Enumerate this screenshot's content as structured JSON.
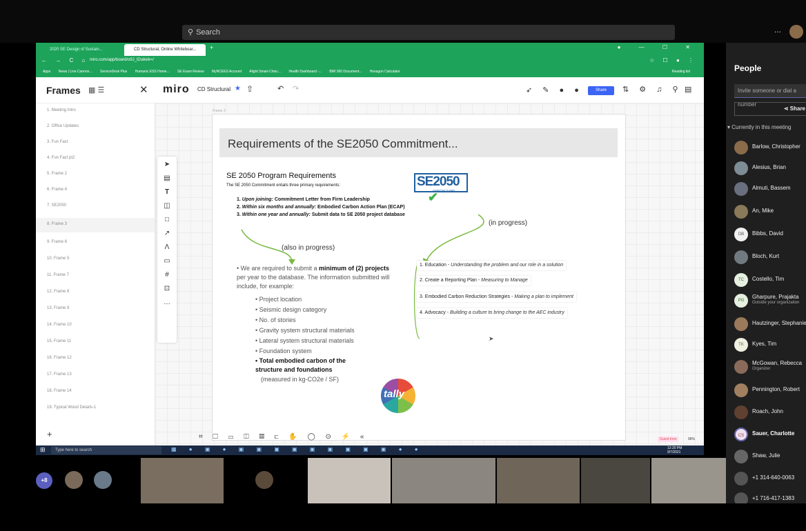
{
  "teams": {
    "search_placeholder": "Search",
    "more": "...",
    "people": {
      "title": "People",
      "invite_placeholder": "Invite someone or dial a number",
      "share_label": "Share",
      "section_label": "Currently in this meeting",
      "members": [
        {
          "name": "Barlow, Christopher",
          "initials": "",
          "sub": ""
        },
        {
          "name": "Alesius, Brian",
          "initials": "",
          "sub": ""
        },
        {
          "name": "Almuti, Bassem",
          "initials": "",
          "sub": ""
        },
        {
          "name": "An, Mike",
          "initials": "",
          "sub": ""
        },
        {
          "name": "Bibbs, David",
          "initials": "DB",
          "sub": ""
        },
        {
          "name": "Bloch, Kurt",
          "initials": "",
          "sub": ""
        },
        {
          "name": "Costello, Tim",
          "initials": "TC",
          "sub": ""
        },
        {
          "name": "Gharpure, Prajakta",
          "initials": "PG",
          "sub": "Outside your organization"
        },
        {
          "name": "Hautzinger, Stephanie",
          "initials": "",
          "sub": ""
        },
        {
          "name": "Kyes, Tim",
          "initials": "TK",
          "sub": ""
        },
        {
          "name": "McGowan, Rebecca",
          "initials": "",
          "sub": "Organizer"
        },
        {
          "name": "Pennington, Robert",
          "initials": "",
          "sub": ""
        },
        {
          "name": "Roach, John",
          "initials": "",
          "sub": ""
        },
        {
          "name": "Sauer, Charlotte",
          "initials": "CS",
          "sub": ""
        },
        {
          "name": "Shaw, Julie",
          "initials": "",
          "sub": ""
        },
        {
          "name": "+1 314-640-0063",
          "initials": "",
          "sub": ""
        },
        {
          "name": "+1 716-417-1383",
          "initials": "",
          "sub": ""
        }
      ]
    },
    "more_participants": "+8"
  },
  "browser": {
    "tabs": [
      "2020 SE Design of Sustain... ",
      "CD Structural, Online Whiteboar..."
    ],
    "url": "miro.com/app/board/o9J_lDuikek=/",
    "bookmarks": [
      "Apps",
      "News | Live.Cannon...",
      "ServiceDesk Plus",
      "Humanic ESS Home...",
      "SE Exam Review",
      "MyNCEES Account",
      "Alight Smart-Choic...",
      "Health Dashboard -...",
      "BIM 360 Document...",
      "Hexagon Calculator"
    ],
    "reading_list": "Reading list"
  },
  "miro": {
    "frames_title": "Frames",
    "logo": "miro",
    "board_name": "CD Structural",
    "share_label": "Share",
    "frames": [
      "1. Meeting Intro",
      "2. Office Updates",
      "3. Fun Fact",
      "4. Fun Fact pt2",
      "5. Frame 2",
      "6. Frame 4",
      "7. SE2050",
      "8. Frame 3",
      "9. Frame 6",
      "10. Frame 5",
      "11. Frame 7",
      "12. Frame 8",
      "13. Frame 9",
      "14. Frame 10",
      "15. Frame 11",
      "16. Frame 12",
      "17. Frame 13",
      "18. Frame 14",
      "19. Typical Wood Details-1"
    ],
    "active_frame_index": 7,
    "frame_label": "Frame 3",
    "guest_badge": "Guest Inno",
    "zoom": "96%"
  },
  "slide": {
    "title": "Requirements of the SE2050 Commitment...",
    "req_title": "SE 2050 Program Requirements",
    "req_intro": "The SE 2050 Commitment entails three primary requirements:",
    "logo": "SE2050",
    "logo_sub": "COMMITTED TO ZERO",
    "requirements": [
      {
        "num": "1.",
        "lead": "Upon joining:",
        "text": " Commitment Letter from Firm Leadership"
      },
      {
        "num": "2.",
        "lead": "Within six months and annually:",
        "text": " Embodied Carbon Action Plan (ECAP)"
      },
      {
        "num": "3.",
        "lead": "Within one year and annually:",
        "text": " Submit data to SE 2050 project database"
      }
    ],
    "in_progress": "(in progress)",
    "also_in_progress": "(also in progress)",
    "bullet_pre": "We are required to submit a ",
    "bullet_bold": "minimum of (2) projects",
    "bullet_post": " per year to the database.  The information submitted will include, for example:",
    "sub_items": [
      "Project location",
      "Seismic design category",
      "No. of stories",
      "Gravity system structural materials",
      "Lateral system structural materials",
      "Foundation system"
    ],
    "sub_last": "Total embodied carbon of the structure and foundations",
    "sub_unit": "(measured in kg-CO2e / SF)",
    "tally": "tally",
    "strategies": [
      {
        "lead": "1.  Education - ",
        "em": "Understanding the problem and our role in a solution"
      },
      {
        "lead": "2.  Create a Reporting Plan - ",
        "em": "Measuring to Manage"
      },
      {
        "lead": "3.  Embodied Carbon Reduction Strategies - ",
        "em": "Making a plan to implement"
      },
      {
        "lead": "4.  Advocacy - ",
        "em": "Building a culture to bring change to the AEC industry"
      }
    ]
  },
  "taskbar": {
    "search_placeholder": "Type here to search",
    "time": "12:20 PM",
    "date": "9/7/2021"
  }
}
